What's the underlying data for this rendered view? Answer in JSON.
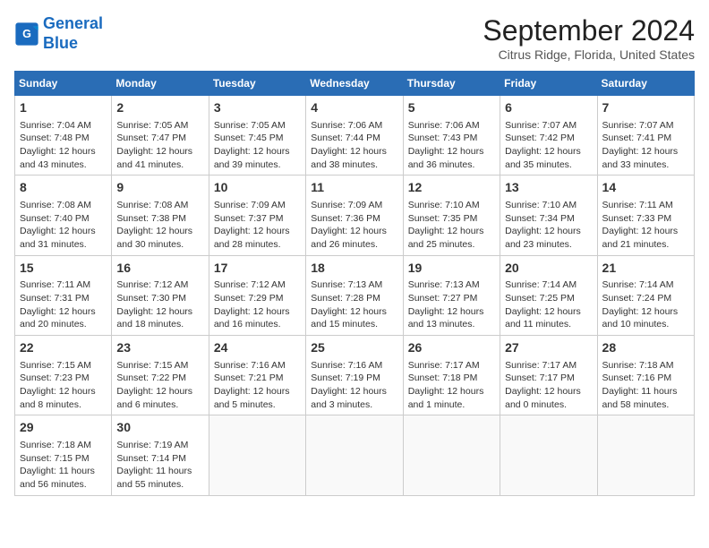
{
  "logo": {
    "line1": "General",
    "line2": "Blue"
  },
  "title": "September 2024",
  "subtitle": "Citrus Ridge, Florida, United States",
  "days_of_week": [
    "Sunday",
    "Monday",
    "Tuesday",
    "Wednesday",
    "Thursday",
    "Friday",
    "Saturday"
  ],
  "weeks": [
    [
      {
        "day": "1",
        "info": "Sunrise: 7:04 AM\nSunset: 7:48 PM\nDaylight: 12 hours\nand 43 minutes."
      },
      {
        "day": "2",
        "info": "Sunrise: 7:05 AM\nSunset: 7:47 PM\nDaylight: 12 hours\nand 41 minutes."
      },
      {
        "day": "3",
        "info": "Sunrise: 7:05 AM\nSunset: 7:45 PM\nDaylight: 12 hours\nand 39 minutes."
      },
      {
        "day": "4",
        "info": "Sunrise: 7:06 AM\nSunset: 7:44 PM\nDaylight: 12 hours\nand 38 minutes."
      },
      {
        "day": "5",
        "info": "Sunrise: 7:06 AM\nSunset: 7:43 PM\nDaylight: 12 hours\nand 36 minutes."
      },
      {
        "day": "6",
        "info": "Sunrise: 7:07 AM\nSunset: 7:42 PM\nDaylight: 12 hours\nand 35 minutes."
      },
      {
        "day": "7",
        "info": "Sunrise: 7:07 AM\nSunset: 7:41 PM\nDaylight: 12 hours\nand 33 minutes."
      }
    ],
    [
      {
        "day": "8",
        "info": "Sunrise: 7:08 AM\nSunset: 7:40 PM\nDaylight: 12 hours\nand 31 minutes."
      },
      {
        "day": "9",
        "info": "Sunrise: 7:08 AM\nSunset: 7:38 PM\nDaylight: 12 hours\nand 30 minutes."
      },
      {
        "day": "10",
        "info": "Sunrise: 7:09 AM\nSunset: 7:37 PM\nDaylight: 12 hours\nand 28 minutes."
      },
      {
        "day": "11",
        "info": "Sunrise: 7:09 AM\nSunset: 7:36 PM\nDaylight: 12 hours\nand 26 minutes."
      },
      {
        "day": "12",
        "info": "Sunrise: 7:10 AM\nSunset: 7:35 PM\nDaylight: 12 hours\nand 25 minutes."
      },
      {
        "day": "13",
        "info": "Sunrise: 7:10 AM\nSunset: 7:34 PM\nDaylight: 12 hours\nand 23 minutes."
      },
      {
        "day": "14",
        "info": "Sunrise: 7:11 AM\nSunset: 7:33 PM\nDaylight: 12 hours\nand 21 minutes."
      }
    ],
    [
      {
        "day": "15",
        "info": "Sunrise: 7:11 AM\nSunset: 7:31 PM\nDaylight: 12 hours\nand 20 minutes."
      },
      {
        "day": "16",
        "info": "Sunrise: 7:12 AM\nSunset: 7:30 PM\nDaylight: 12 hours\nand 18 minutes."
      },
      {
        "day": "17",
        "info": "Sunrise: 7:12 AM\nSunset: 7:29 PM\nDaylight: 12 hours\nand 16 minutes."
      },
      {
        "day": "18",
        "info": "Sunrise: 7:13 AM\nSunset: 7:28 PM\nDaylight: 12 hours\nand 15 minutes."
      },
      {
        "day": "19",
        "info": "Sunrise: 7:13 AM\nSunset: 7:27 PM\nDaylight: 12 hours\nand 13 minutes."
      },
      {
        "day": "20",
        "info": "Sunrise: 7:14 AM\nSunset: 7:25 PM\nDaylight: 12 hours\nand 11 minutes."
      },
      {
        "day": "21",
        "info": "Sunrise: 7:14 AM\nSunset: 7:24 PM\nDaylight: 12 hours\nand 10 minutes."
      }
    ],
    [
      {
        "day": "22",
        "info": "Sunrise: 7:15 AM\nSunset: 7:23 PM\nDaylight: 12 hours\nand 8 minutes."
      },
      {
        "day": "23",
        "info": "Sunrise: 7:15 AM\nSunset: 7:22 PM\nDaylight: 12 hours\nand 6 minutes."
      },
      {
        "day": "24",
        "info": "Sunrise: 7:16 AM\nSunset: 7:21 PM\nDaylight: 12 hours\nand 5 minutes."
      },
      {
        "day": "25",
        "info": "Sunrise: 7:16 AM\nSunset: 7:19 PM\nDaylight: 12 hours\nand 3 minutes."
      },
      {
        "day": "26",
        "info": "Sunrise: 7:17 AM\nSunset: 7:18 PM\nDaylight: 12 hours\nand 1 minute."
      },
      {
        "day": "27",
        "info": "Sunrise: 7:17 AM\nSunset: 7:17 PM\nDaylight: 12 hours\nand 0 minutes."
      },
      {
        "day": "28",
        "info": "Sunrise: 7:18 AM\nSunset: 7:16 PM\nDaylight: 11 hours\nand 58 minutes."
      }
    ],
    [
      {
        "day": "29",
        "info": "Sunrise: 7:18 AM\nSunset: 7:15 PM\nDaylight: 11 hours\nand 56 minutes."
      },
      {
        "day": "30",
        "info": "Sunrise: 7:19 AM\nSunset: 7:14 PM\nDaylight: 11 hours\nand 55 minutes."
      },
      {
        "day": "",
        "info": ""
      },
      {
        "day": "",
        "info": ""
      },
      {
        "day": "",
        "info": ""
      },
      {
        "day": "",
        "info": ""
      },
      {
        "day": "",
        "info": ""
      }
    ]
  ]
}
